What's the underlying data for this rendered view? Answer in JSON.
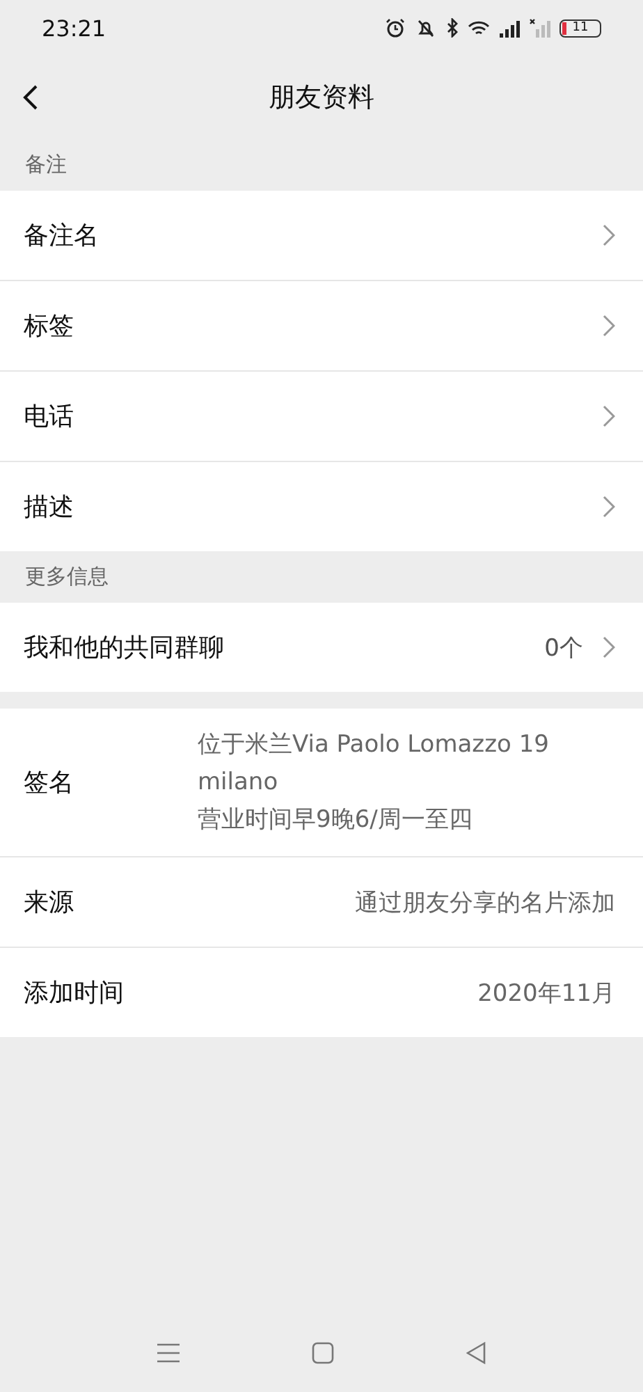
{
  "status_bar": {
    "time": "23:21",
    "battery": "11"
  },
  "header": {
    "title": "朋友资料"
  },
  "sections": [
    {
      "label": "备注",
      "rows": [
        {
          "kind": "link",
          "label": "备注名"
        },
        {
          "kind": "link",
          "label": "标签"
        },
        {
          "kind": "link",
          "label": "电话"
        },
        {
          "kind": "link",
          "label": "描述"
        }
      ]
    },
    {
      "label": "更多信息",
      "rows": [
        {
          "kind": "link",
          "label": "我和他的共同群聊",
          "value": "0个"
        }
      ]
    },
    {
      "rows": [
        {
          "kind": "info",
          "label": "签名",
          "lines": [
            "位于米兰Via Paolo Lomazzo 19",
            "milano",
            "营业时间早9晚6/周一至四"
          ]
        },
        {
          "kind": "info",
          "label": "来源",
          "value": "通过朋友分享的名片添加"
        },
        {
          "kind": "info",
          "label": "添加时间",
          "value": "2020年11月"
        }
      ]
    }
  ]
}
